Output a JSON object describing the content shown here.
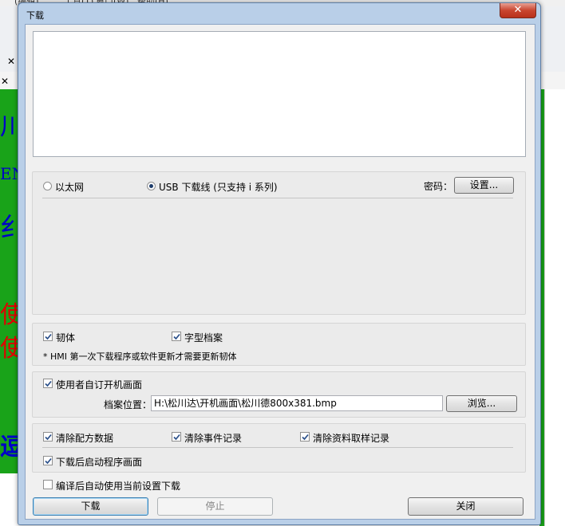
{
  "background": {
    "menu_items": [
      "(编辑)",
      "工具(T)",
      "窗口(W)",
      "帮助(H)"
    ],
    "close_glyph": "✕",
    "left_panel_glyphs": [
      "川",
      "EN",
      "纟",
      "使",
      "逗",
      ":("
    ]
  },
  "dialog": {
    "title": "下载",
    "close_glyph": "✕",
    "connection": {
      "ethernet_label": "以太网",
      "usb_label": "USB 下载线 (只支持 i 系列)",
      "selected": "usb",
      "password_label": "密码：",
      "settings_button": "设置..."
    },
    "firmware": {
      "firmware_label": "韧体",
      "firmware_checked": true,
      "font_label": "字型档案",
      "font_checked": true,
      "note": "* HMI 第一次下载程序或软件更新才需要更新韧体"
    },
    "startup": {
      "custom_screen_label": "使用者自订开机画面",
      "custom_screen_checked": true,
      "file_location_label": "档案位置：",
      "file_path": "H:\\松川达\\开机画面\\松川德800x381.bmp",
      "browse_button": "浏览..."
    },
    "clear": {
      "recipe_label": "清除配方数据",
      "recipe_checked": true,
      "event_label": "清除事件记录",
      "event_checked": true,
      "sampling_label": "清除资料取样记录",
      "sampling_checked": true,
      "start_screen_label": "下载后启动程序画面",
      "start_screen_checked": true
    },
    "auto_download_label": "编译后自动使用当前设置下载",
    "auto_download_checked": false,
    "buttons": {
      "download": "下载",
      "stop": "停止",
      "close": "关闭"
    }
  }
}
